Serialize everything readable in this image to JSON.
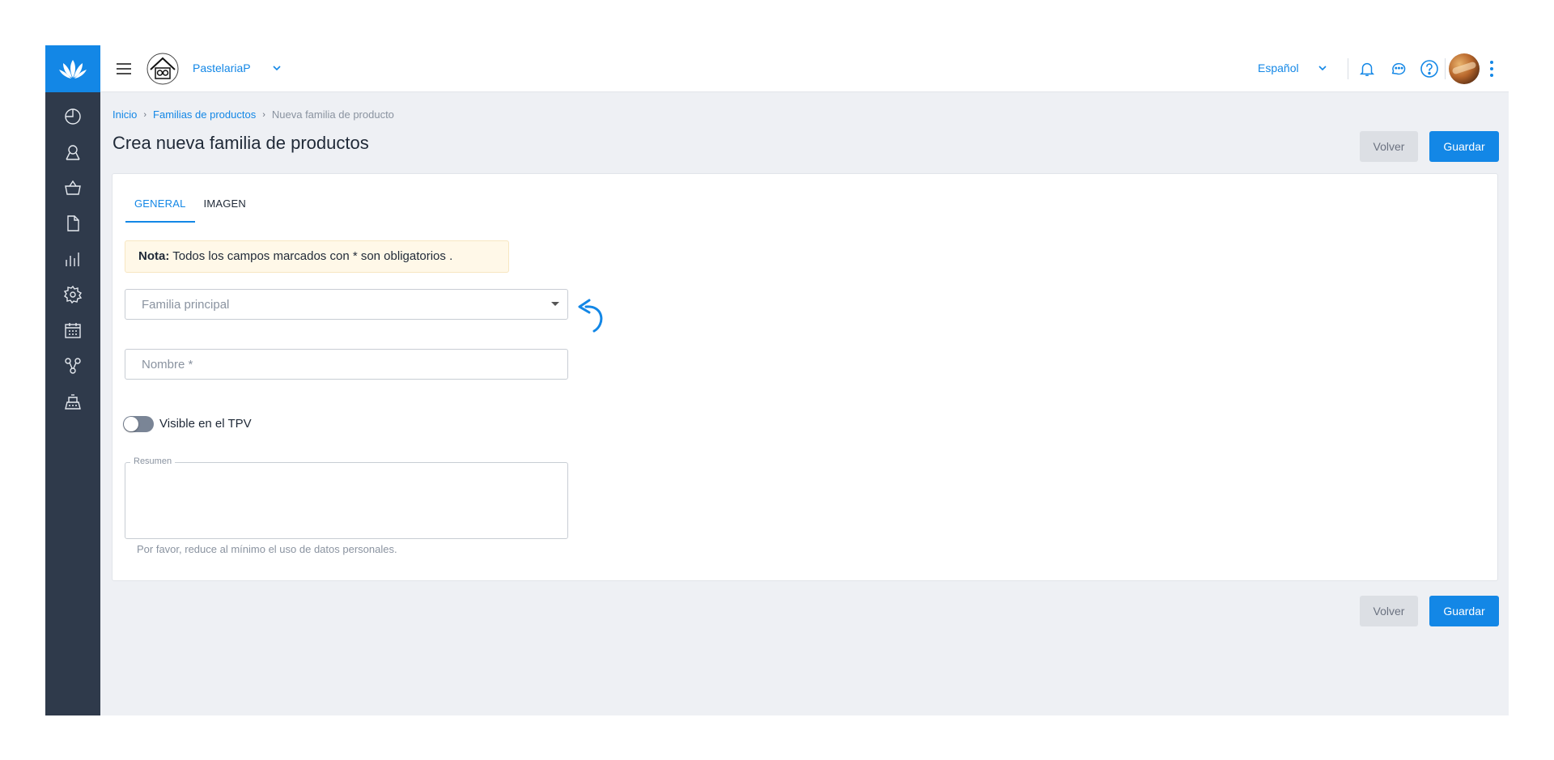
{
  "header": {
    "shop_name": "PastelariaP",
    "language": "Español"
  },
  "breadcrumb": {
    "home": "Inicio",
    "families": "Familias de productos",
    "current": "Nueva familia de producto"
  },
  "page": {
    "title": "Crea nueva familia de productos",
    "back_label": "Volver",
    "save_label": "Guardar"
  },
  "tabs": {
    "general": "GENERAL",
    "image": "IMAGEN"
  },
  "note": {
    "bold": "Nota:",
    "text": " Todos los campos marcados con * son obligatorios ."
  },
  "form": {
    "parent_family_placeholder": "Familia principal",
    "name_placeholder": "Nombre *",
    "visible_tpv_label": "Visible en el TPV",
    "visible_tpv_on": false,
    "summary_label": "Resumen",
    "summary_hint": "Por favor, reduce al mínimo el uso de datos personales."
  },
  "colors": {
    "accent": "#1387e6",
    "sidebar": "#2f3a4b",
    "background": "#eef0f4"
  },
  "icons": {
    "sidebar": [
      "dashboard-icon",
      "user-icon",
      "basket-icon",
      "document-icon",
      "reports-icon",
      "settings-icon",
      "calendar-icon",
      "integrations-icon",
      "cash-register-icon"
    ],
    "header": [
      "menu-icon",
      "bell-icon",
      "chat-icon",
      "help-icon"
    ]
  }
}
